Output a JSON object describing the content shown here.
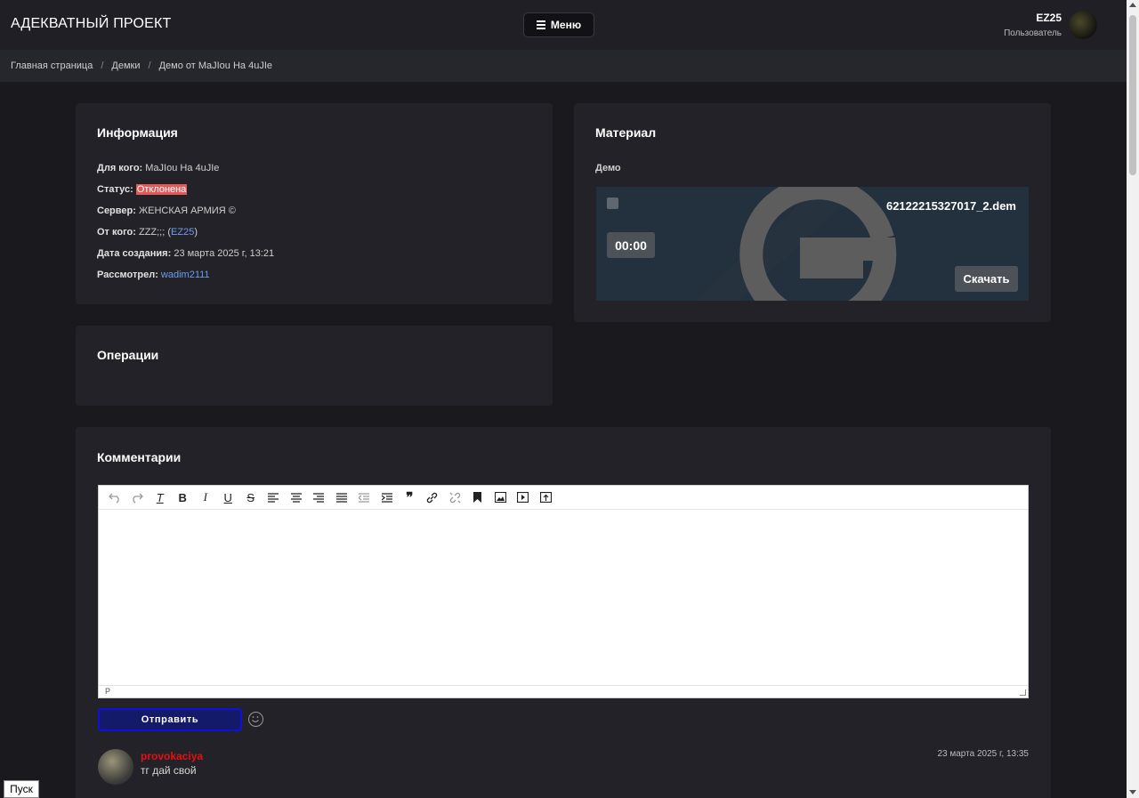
{
  "header": {
    "brand": "АДЕКВАТНЫЙ ПРОЕКТ",
    "menu_label": "Меню",
    "user_name": "EZ25",
    "user_role": "Пользователь"
  },
  "breadcrumb": [
    "Главная страница",
    "Демки",
    "Демо от MaJIou Ha 4uJIe"
  ],
  "info": {
    "title": "Информация",
    "for_label": "Для кого:",
    "for_value": "MaJIou Ha 4uJIe",
    "status_label": "Статус:",
    "status_value": "Отклонена",
    "server_label": "Сервер:",
    "server_value": "ЖЕНСКАЯ АРМИЯ ©",
    "from_label": "От кого:",
    "from_value": "ZZZ;;; (",
    "from_link": "EZ25",
    "from_close": ")",
    "created_label": "Дата создания:",
    "created_value": "23 марта 2025 г, 13:21",
    "reviewed_label": "Рассмотрел:",
    "reviewed_value": "wadim2111"
  },
  "operations": {
    "title": "Операции"
  },
  "material": {
    "title": "Материал",
    "subtitle": "Демо",
    "file_name": "62122215327017_2.dem",
    "time": "00:00",
    "download_label": "Скачать"
  },
  "comments": {
    "title": "Комментарии",
    "editor_status": "P",
    "toolbar_icons": [
      "undo-icon",
      "redo-icon",
      "clear-format-icon",
      "bold-icon",
      "italic-icon",
      "underline-icon",
      "strikethrough-icon",
      "align-left-icon",
      "align-center-icon",
      "align-right-icon",
      "align-justify-icon",
      "outdent-icon",
      "indent-icon",
      "blockquote-icon",
      "link-icon",
      "unlink-icon",
      "bookmark-icon",
      "image-icon",
      "media-icon",
      "upload-icon"
    ],
    "send_label": "Отправить",
    "items": [
      {
        "author": "provokaciya",
        "text": "тг дай свой",
        "date": "23 марта 2025 г, 13:35"
      }
    ]
  },
  "taskbar": {
    "start_label": "Пуск"
  },
  "colors": {
    "background": "#19191e",
    "card": "#222228",
    "status_rejected": "#e05a5a",
    "link": "#6e9ef0",
    "author": "#e8100f"
  }
}
